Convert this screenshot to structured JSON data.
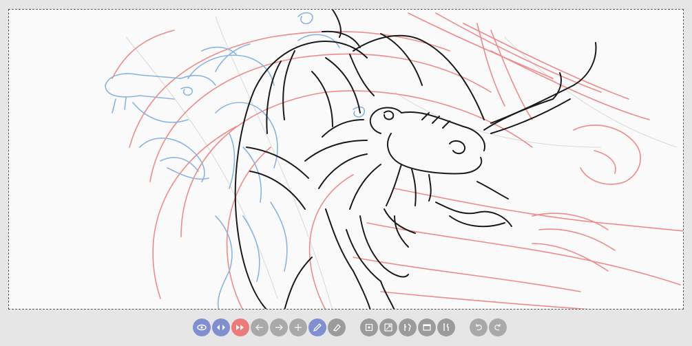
{
  "app": {
    "canvas": {
      "name": "dragon-sketch-canvas",
      "layers": [
        "blue-draft-layer",
        "red-draft-layer",
        "black-lineart-layer"
      ]
    },
    "colors": {
      "background": "#e6e6e6",
      "canvas": "#fafafa",
      "button": "#9b9b9b",
      "button_blue": "#7f8fcf",
      "button_red": "#ec7a7a",
      "stroke_black": "#1a1a1a",
      "stroke_blue": "#8ab4e0",
      "stroke_red": "#ef8a8a"
    }
  },
  "toolbar": {
    "buttons": [
      {
        "name": "layer-blue-toggle",
        "icon": "eye-icon",
        "color": "blue"
      },
      {
        "name": "layer-mix-toggle",
        "icon": "transfer-icon",
        "color": "blue"
      },
      {
        "name": "layer-red-toggle",
        "icon": "transfer-icon",
        "color": "red"
      },
      {
        "name": "prev-frame",
        "icon": "arrow-left-icon"
      },
      {
        "name": "next-frame",
        "icon": "arrow-right-icon"
      },
      {
        "name": "add-frame",
        "icon": "plus-icon"
      },
      {
        "name": "pencil-tool",
        "icon": "pencil-icon",
        "color": "blue"
      },
      {
        "name": "eraser-tool",
        "icon": "eraser-icon"
      },
      {
        "name": "select-tool",
        "icon": "select-square-icon"
      },
      {
        "name": "transform-tool",
        "icon": "resize-icon"
      },
      {
        "name": "brush-settings",
        "icon": "brush-settings-icon"
      },
      {
        "name": "panel-toggle",
        "icon": "window-icon"
      },
      {
        "name": "tools-settings",
        "icon": "wrench-icon"
      },
      {
        "name": "undo",
        "icon": "undo-icon"
      },
      {
        "name": "redo",
        "icon": "redo-icon"
      }
    ]
  }
}
